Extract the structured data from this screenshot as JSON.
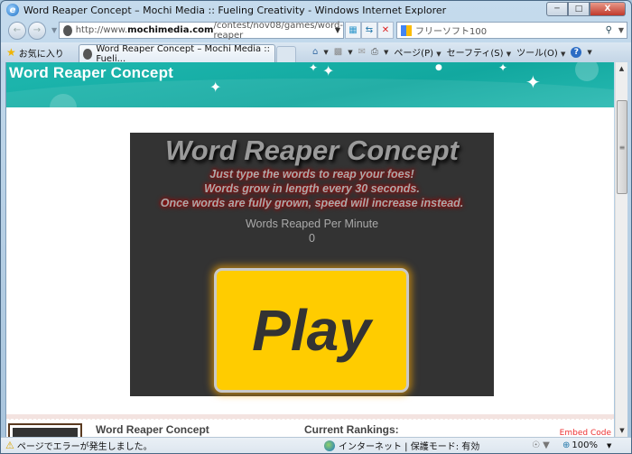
{
  "window": {
    "title": "Word Reaper Concept – Mochi Media :: Fueling Creativity - Windows Internet Explorer",
    "minimize_icon": "minimize-icon",
    "maximize_icon": "maximize-icon",
    "close_label": "X"
  },
  "nav": {
    "address_prefix": "http://www.",
    "address_domain": "mochimedia.com",
    "address_path": "/contest/nov08/games/word-reaper",
    "search_placeholder": "フリーソフト100"
  },
  "favbar": {
    "favorites_label": "お気に入り",
    "tab_label": "Word Reaper Concept – Mochi Media :: Fueli...",
    "page_menu": "ページ(P)",
    "safety_menu": "セーフティ(S)",
    "tools_menu": "ツール(O)"
  },
  "page": {
    "banner_title": "Word Reaper Concept",
    "game": {
      "title": "Word Reaper Concept",
      "desc_lines": [
        "Just type the words to reap your foes!",
        "Words grow in length every 30 seconds.",
        "Once words are fully grown, speed will increase instead."
      ],
      "wpm_label": "Words Reaped Per Minute",
      "wpm_value": "0",
      "play_label": "Play",
      "play_color": "#ffcc00"
    },
    "lower": {
      "game_name": "Word Reaper Concept",
      "rankings_label": "Current Rankings:",
      "embed_label": "Embed Code"
    }
  },
  "status": {
    "message": "ページでエラーが発生しました。",
    "zone": "インターネット | 保護モード: 有効",
    "zoom": "100%"
  }
}
